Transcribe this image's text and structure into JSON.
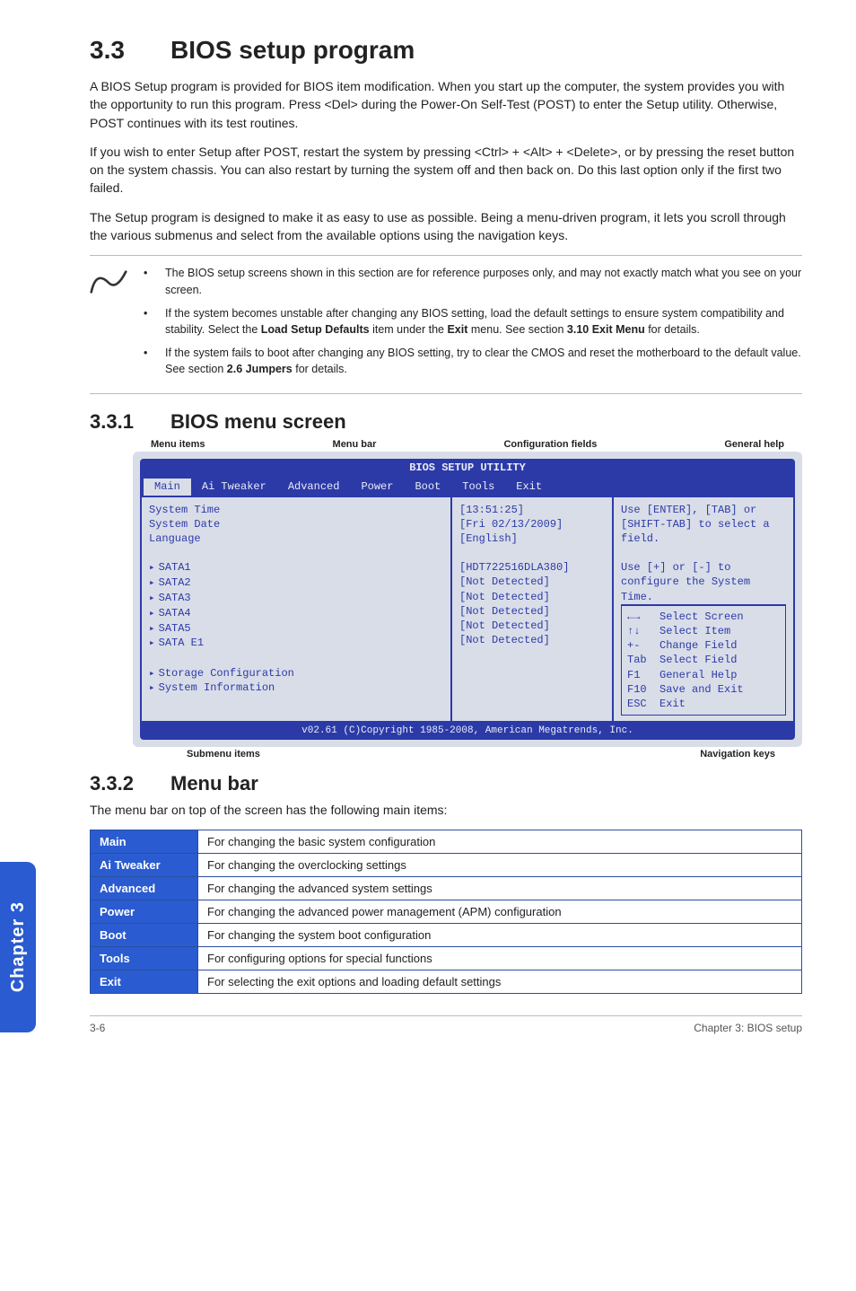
{
  "section": {
    "num": "3.3",
    "title": "BIOS setup program"
  },
  "para1": "A BIOS Setup program is provided for BIOS item modification. When you start up the computer, the system provides you with the opportunity to run this program. Press <Del> during the Power-On Self-Test (POST) to enter the Setup utility. Otherwise, POST continues with its test routines.",
  "para2": "If you wish to enter Setup after POST, restart the system by pressing <Ctrl> + <Alt> + <Delete>, or by pressing the reset button on the system chassis. You can also restart by turning the system off and then back on. Do this last option only if the first two failed.",
  "para3": "The Setup program is designed to make it as easy to use as possible. Being a menu-driven program, it lets you scroll through the various submenus and select from the available options using the navigation keys.",
  "notes": [
    "The BIOS setup screens shown in this section are for reference purposes only, and may not exactly match what you see on your screen.",
    "If the system becomes unstable after changing any BIOS setting, load the default settings to ensure system compatibility and stability. Select the <b>Load Setup Defaults</b> item under the <b>Exit</b> menu. See section <b>3.10 Exit Menu</b> for details.",
    "If the system fails to boot after changing any BIOS setting, try to clear the CMOS and reset the motherboard to the default value. See section <b>2.6 Jumpers</b> for details."
  ],
  "sub1": {
    "num": "3.3.1",
    "title": "BIOS menu screen"
  },
  "labels_top": [
    "Menu items",
    "Menu bar",
    "Configuration fields",
    "General help"
  ],
  "labels_bottom": [
    "Submenu items",
    "Navigation keys"
  ],
  "bios": {
    "title": "BIOS SETUP UTILITY",
    "menus": [
      "Main",
      "Ai Tweaker",
      "Advanced",
      "Power",
      "Boot",
      "Tools",
      "Exit"
    ],
    "left": {
      "sys_time": "System Time",
      "sys_date": "System Date",
      "language": "Language",
      "sata": [
        "SATA1",
        "SATA2",
        "SATA3",
        "SATA4",
        "SATA5",
        "SATA E1"
      ],
      "storage": "Storage Configuration",
      "sysinfo": "System Information"
    },
    "mid": {
      "time": "[13:51:25]",
      "date": "[Fri 02/13/2009]",
      "lang": "[English]",
      "sata_vals": [
        "[HDT722516DLA380]",
        "[Not Detected]",
        "[Not Detected]",
        "[Not Detected]",
        "[Not Detected]",
        "[Not Detected]"
      ]
    },
    "right": {
      "help": "Use [ENTER], [TAB] or [SHIFT-TAB] to select a field.\n\nUse [+] or [-] to configure the System Time.",
      "keys": [
        {
          "k": "←→",
          "d": "Select Screen"
        },
        {
          "k": "↑↓",
          "d": "Select Item"
        },
        {
          "k": "+-",
          "d": "Change Field"
        },
        {
          "k": "Tab",
          "d": "Select Field"
        },
        {
          "k": "F1",
          "d": "General Help"
        },
        {
          "k": "F10",
          "d": "Save and Exit"
        },
        {
          "k": "ESC",
          "d": "Exit"
        }
      ]
    },
    "footer": "v02.61 (C)Copyright 1985-2008, American Megatrends, Inc."
  },
  "sub2": {
    "num": "3.3.2",
    "title": "Menu bar"
  },
  "sub2_intro": "The menu bar on top of the screen has the following main items:",
  "table": [
    {
      "k": "Main",
      "v": "For changing the basic system configuration"
    },
    {
      "k": "Ai Tweaker",
      "v": "For changing the overclocking settings"
    },
    {
      "k": "Advanced",
      "v": "For changing the advanced system settings"
    },
    {
      "k": "Power",
      "v": "For changing the advanced power management (APM) configuration"
    },
    {
      "k": "Boot",
      "v": "For changing the system boot configuration"
    },
    {
      "k": "Tools",
      "v": "For configuring options for special functions"
    },
    {
      "k": "Exit",
      "v": "For selecting the exit options and loading default settings"
    }
  ],
  "sidetab": "Chapter 3",
  "footer_left": "3-6",
  "footer_right": "Chapter 3: BIOS setup"
}
